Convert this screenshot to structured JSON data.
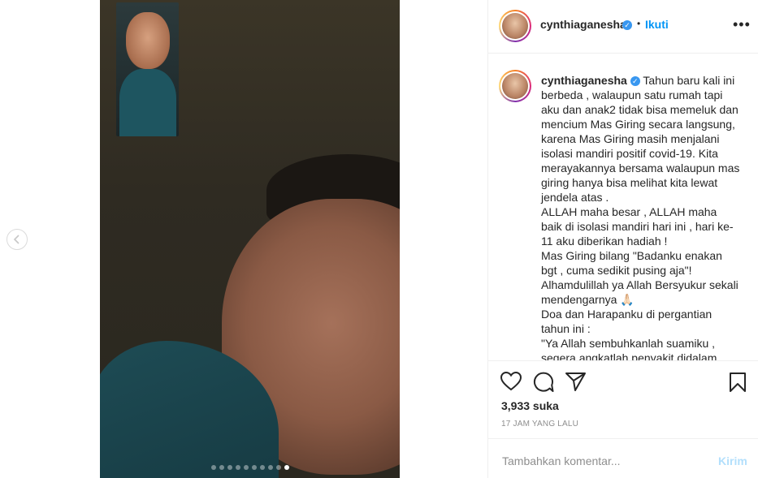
{
  "post": {
    "username": "cynthiaganesha",
    "verified_mark": "✓",
    "follow_separator": "•",
    "follow_label": "Ikuti",
    "more_label": "•••",
    "caption_text": "Tahun baru kali ini berbeda , walaupun satu rumah tapi aku dan anak2 tidak bisa memeluk dan mencium Mas Giring secara langsung, karena Mas Giring masih menjalani isolasi mandiri positif covid-19. Kita merayakannya bersama walaupun mas giring hanya bisa melihat kita lewat jendela atas .\nALLAH maha besar , ALLAH maha baik di isolasi mandiri hari ini , hari ke-11 aku diberikan hadiah !\nMas Giring bilang \"Badanku enakan bgt , cuma sedikit pusing aja\"!\nAlhamdulillah ya Allah Bersyukur sekali mendengarnya 🙏🏻\nDoa dan Harapanku di pergantian tahun ini :\n\"Ya Allah sembuhkanlah suamiku , segera angkatlah penyakit didalam",
    "likes": "3,933 suka",
    "timestamp": "17 JAM YANG LALU",
    "comment_placeholder": "Tambahkan komentar...",
    "post_button": "Kirim"
  },
  "carousel": {
    "total_slides": 10,
    "active_slide": 10
  },
  "icons": {
    "prev": "chevron-left-icon",
    "like": "heart-icon",
    "comment": "comment-icon",
    "share": "paper-plane-icon",
    "save": "bookmark-icon",
    "more": "more-icon"
  },
  "colors": {
    "link": "#0095f6",
    "verified": "#3897f0",
    "post_button_disabled": "#b2dffc",
    "muted": "#8e8e8e"
  }
}
